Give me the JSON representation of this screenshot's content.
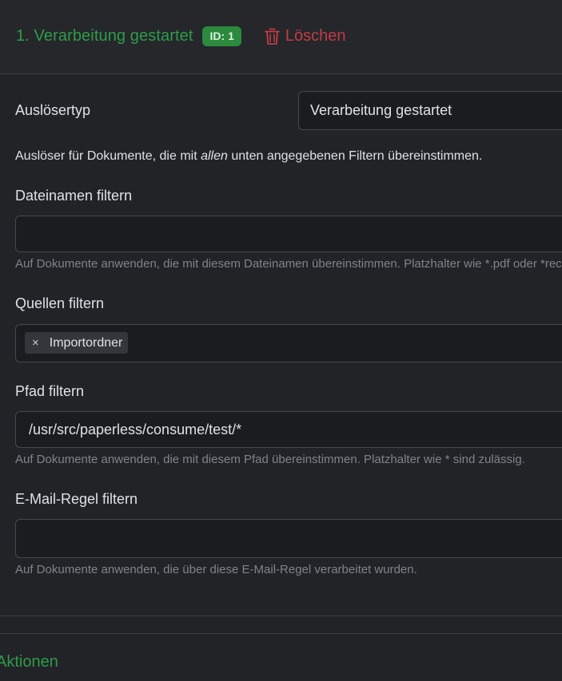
{
  "header": {
    "trigger_title": "1. Verarbeitung gestartet",
    "id_badge": "ID: 1",
    "delete_label": "Löschen"
  },
  "trigger_type": {
    "label": "Auslösertyp",
    "value": "Verarbeitung gestartet"
  },
  "description": {
    "prefix": "Auslöser für Dokumente, die mit ",
    "emphasis": "allen",
    "suffix": " unten angegebenen Filtern übereinstimmen."
  },
  "filename_filter": {
    "label": "Dateinamen filtern",
    "value": "",
    "hint": "Auf Dokumente anwenden, die mit diesem Dateinamen übereinstimmen. Platzhalter wie *.pdf oder *rechnung* sind zulässig."
  },
  "sources_filter": {
    "label": "Quellen filtern",
    "chips": [
      {
        "remove": "×",
        "label": "Importordner"
      }
    ]
  },
  "path_filter": {
    "label": "Pfad filtern",
    "value": "/usr/src/paperless/consume/test/*",
    "hint": "Auf Dokumente anwenden, die mit diesem Pfad übereinstimmen. Platzhalter wie * sind zulässig."
  },
  "mailrule_filter": {
    "label": "E-Mail-Regel filtern",
    "value": "",
    "hint": "Auf Dokumente anwenden, die über diese E-Mail-Regel verarbeitet wurden."
  },
  "actions_section": {
    "title": "Aktionen"
  },
  "colors": {
    "accent_green": "#2e9c49",
    "badge_green": "#2b8a3e",
    "danger_red": "#c23b46",
    "background": "#212327"
  }
}
